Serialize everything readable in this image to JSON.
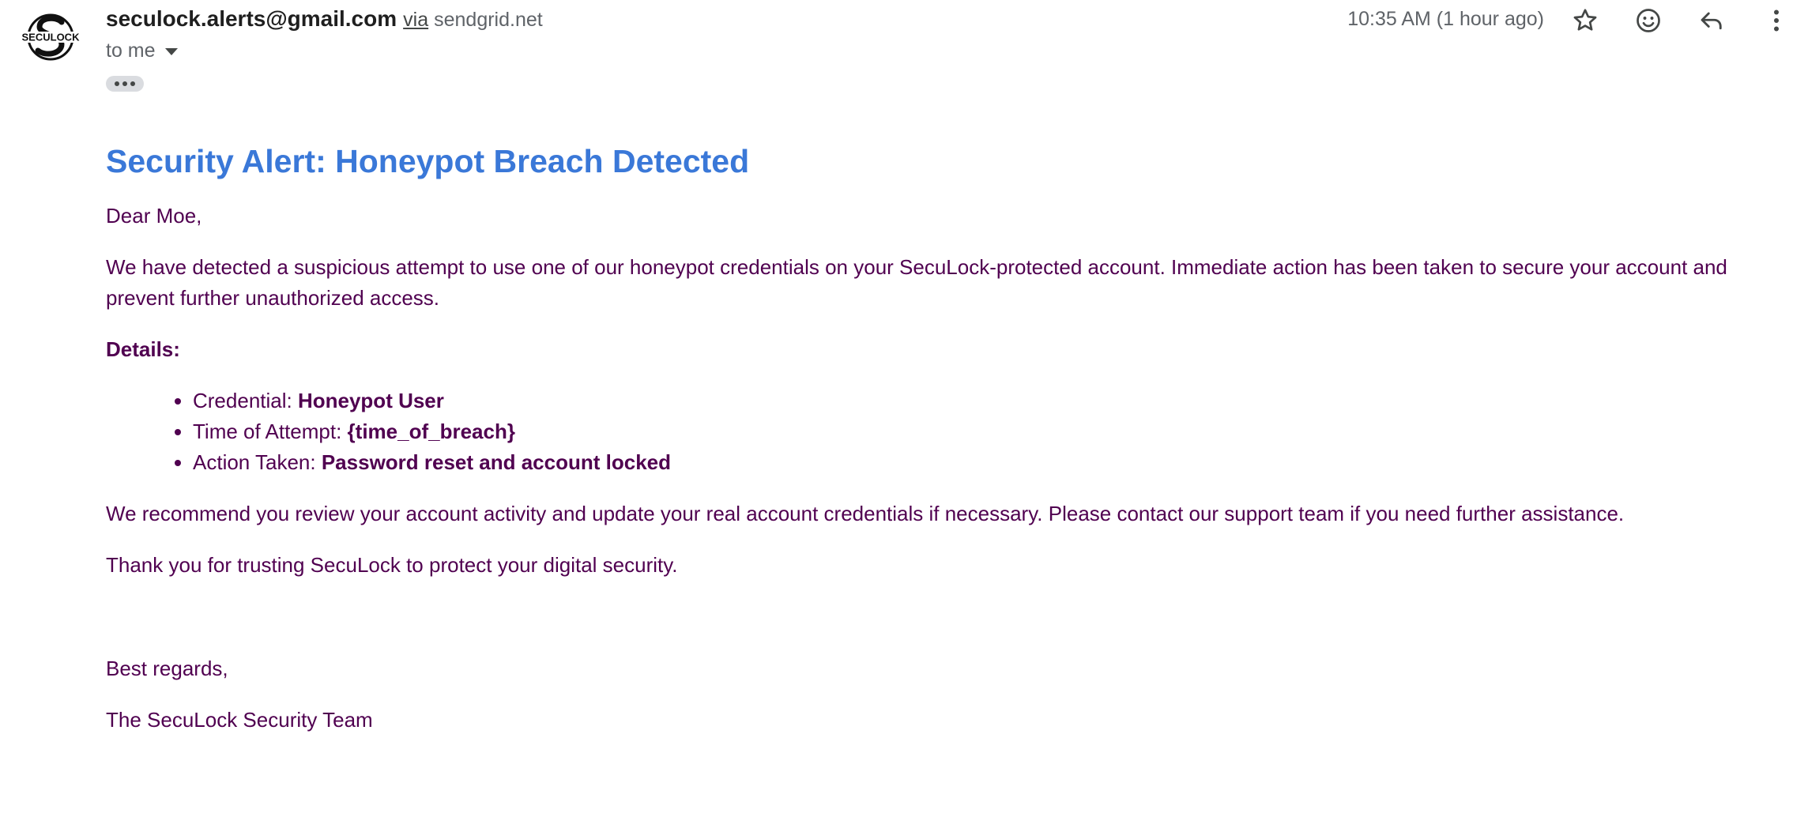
{
  "header": {
    "sender_email": "seculock.alerts@gmail.com",
    "via_label": "via",
    "via_domain": "sendgrid.net",
    "recipient": "to me",
    "timestamp": "10:35 AM (1 hour ago)",
    "logo_text": "SECULOCK",
    "icons": [
      "star-icon",
      "emoji-icon",
      "reply-icon",
      "more-vert-icon",
      "chevron-down-icon",
      "ellipsis-icon"
    ]
  },
  "email": {
    "title": "Security Alert: Honeypot Breach Detected",
    "greeting": "Dear Moe,",
    "intro": "We have detected a suspicious attempt to use one of our honeypot credentials on your SecuLock-protected account. Immediate action has been taken to secure your account and prevent further unauthorized access.",
    "details_heading": "Details:",
    "details": [
      {
        "label": "Credential: ",
        "value": "Honeypot User"
      },
      {
        "label": "Time of Attempt: ",
        "value": "{time_of_breach}"
      },
      {
        "label": "Action Taken: ",
        "value": "Password reset and account locked"
      }
    ],
    "recommendation": "We recommend you review your account activity and update your real account credentials if necessary. Please contact our support team if you need further assistance.",
    "thanks": "Thank you for trusting SecuLock to protect your digital security.",
    "closing": "Best regards,",
    "signature": "The SecuLock Security Team"
  },
  "colors": {
    "title": "#3a78d8",
    "body_text": "#500050",
    "meta_text": "#5f6368"
  }
}
